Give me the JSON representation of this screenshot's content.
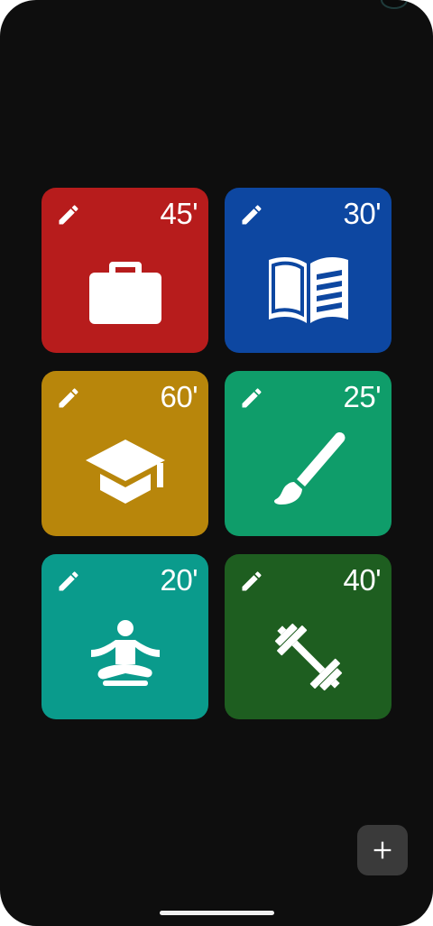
{
  "app": {
    "background": "#0e0e0e"
  },
  "tiles": [
    {
      "minutes": "45'",
      "activity": "work",
      "icon": "briefcase-icon",
      "color": "#b71c1c"
    },
    {
      "minutes": "30'",
      "activity": "reading",
      "icon": "book-icon",
      "color": "#0d47a1"
    },
    {
      "minutes": "60'",
      "activity": "study",
      "icon": "graduation-cap-icon",
      "color": "#b8860b"
    },
    {
      "minutes": "25'",
      "activity": "painting",
      "icon": "paint-brush-icon",
      "color": "#0f9d6a"
    },
    {
      "minutes": "20'",
      "activity": "meditation",
      "icon": "meditation-icon",
      "color": "#0a9b8c"
    },
    {
      "minutes": "40'",
      "activity": "workout",
      "icon": "dumbbell-icon",
      "color": "#1e5e20"
    }
  ],
  "fab": {
    "icon": "plus-icon",
    "color": "#3a3a3a"
  }
}
